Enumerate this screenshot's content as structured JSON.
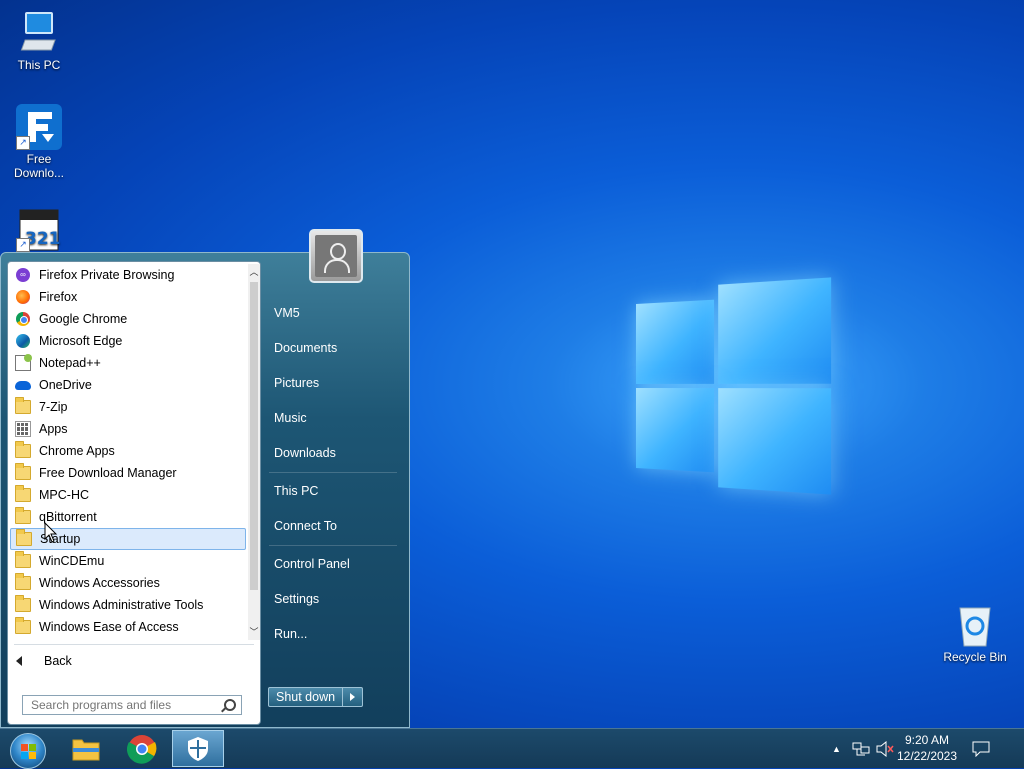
{
  "desktop": {
    "icons": [
      {
        "label": "This PC"
      },
      {
        "label": "Free Downlo..."
      },
      {
        "label": ""
      },
      {
        "label": "Recycle Bin"
      }
    ]
  },
  "start_menu": {
    "programs": [
      {
        "label": "Firefox Private Browsing",
        "icon": "firefox-private-icon"
      },
      {
        "label": "Firefox",
        "icon": "firefox-icon"
      },
      {
        "label": "Google Chrome",
        "icon": "chrome-icon"
      },
      {
        "label": "Microsoft Edge",
        "icon": "edge-icon"
      },
      {
        "label": "Notepad++",
        "icon": "notepadpp-icon"
      },
      {
        "label": "OneDrive",
        "icon": "onedrive-icon"
      },
      {
        "label": "7-Zip",
        "icon": "folder-icon"
      },
      {
        "label": "Apps",
        "icon": "apps-icon"
      },
      {
        "label": "Chrome Apps",
        "icon": "folder-icon"
      },
      {
        "label": "Free Download Manager",
        "icon": "folder-icon"
      },
      {
        "label": "MPC-HC",
        "icon": "folder-icon"
      },
      {
        "label": "qBittorrent",
        "icon": "folder-icon"
      },
      {
        "label": "Startup",
        "icon": "folder-icon"
      },
      {
        "label": "WinCDEmu",
        "icon": "folder-icon"
      },
      {
        "label": "Windows Accessories",
        "icon": "folder-icon"
      },
      {
        "label": "Windows Administrative Tools",
        "icon": "folder-icon"
      },
      {
        "label": "Windows Ease of Access",
        "icon": "folder-icon"
      }
    ],
    "selected_index": 12,
    "back_label": "Back",
    "search_placeholder": "Search programs and files",
    "right_items": [
      {
        "label": "VM5"
      },
      {
        "label": "Documents"
      },
      {
        "label": "Pictures"
      },
      {
        "label": "Music"
      },
      {
        "label": "Downloads"
      },
      {
        "label": "This PC"
      },
      {
        "label": "Connect To"
      },
      {
        "label": "Control Panel"
      },
      {
        "label": "Settings"
      },
      {
        "label": "Run..."
      }
    ],
    "shutdown_label": "Shut down"
  },
  "taskbar": {
    "pinned": [
      {
        "icon": "file-explorer-icon"
      },
      {
        "icon": "chrome-icon"
      },
      {
        "icon": "windows-security-icon",
        "active": true
      }
    ],
    "clock": {
      "time": "9:20 AM",
      "date": "12/22/2023"
    }
  },
  "colors": {
    "accent": "#0b5ed8",
    "start_menu": "#1d5674",
    "selection": "#dbeafc"
  }
}
